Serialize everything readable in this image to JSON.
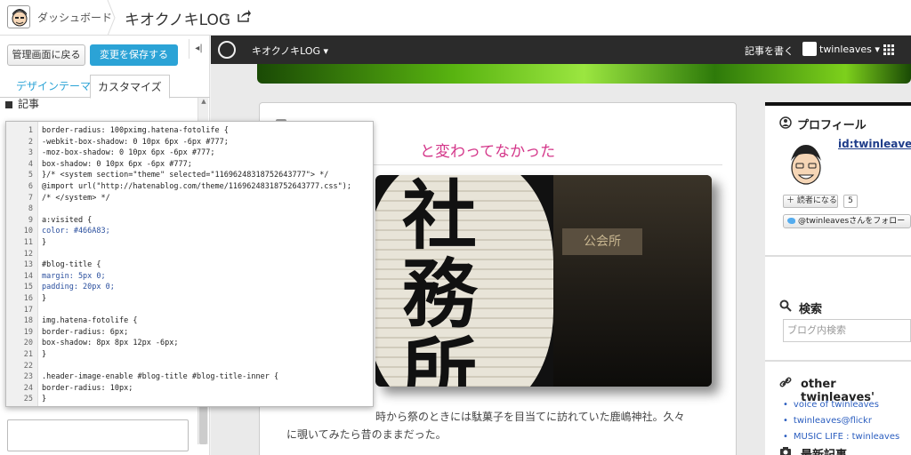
{
  "topbar": {
    "dashboard_label": "ダッシュボード",
    "blog_name": "キオクノキLOG",
    "caret": "▾"
  },
  "leftpane": {
    "back_button": "管理画面に戻る",
    "save_button": "変更を保存する",
    "collapse": "◂|",
    "tabs": [
      {
        "label": "デザインテーマ",
        "active": false
      },
      {
        "label": "カスタマイズ",
        "active": true
      }
    ],
    "section_label": "記事",
    "scroll_up": "▲"
  },
  "editor": {
    "lines": [
      {
        "n": "1",
        "code": "border-radius: 100pximg.hatena-fotolife {"
      },
      {
        "n": "2",
        "code": "-webkit-box-shadow: 0 10px 6px -6px #777;"
      },
      {
        "n": "3",
        "code": "-moz-box-shadow: 0 10px 6px -6px #777;"
      },
      {
        "n": "4",
        "code": "box-shadow: 0 10px 6px -6px #777;"
      },
      {
        "n": "5",
        "code": "}/* <system section=\"theme\" selected=\"11696248318752643777\"> */"
      },
      {
        "n": "6",
        "code": "@import url(\"http://hatenablog.com/theme/11696248318752643777.css\");"
      },
      {
        "n": "7",
        "code": "/* </system> */"
      },
      {
        "n": "8",
        "code": ""
      },
      {
        "n": "9",
        "code": "a:visited {"
      },
      {
        "n": "10",
        "code": "color: #466A83;"
      },
      {
        "n": "11",
        "code": "}"
      },
      {
        "n": "12",
        "code": ""
      },
      {
        "n": "13",
        "code": "#blog-title {"
      },
      {
        "n": "14",
        "code": "margin: 5px 0;"
      },
      {
        "n": "15",
        "code": "padding: 20px 0;"
      },
      {
        "n": "16",
        "code": "}"
      },
      {
        "n": "17",
        "code": ""
      },
      {
        "n": "18",
        "code": "img.hatena-fotolife {"
      },
      {
        "n": "19",
        "code": "border-radius: 6px;"
      },
      {
        "n": "20",
        "code": "box-shadow: 8px 8px 12px -6px;"
      },
      {
        "n": "21",
        "code": "}"
      },
      {
        "n": "22",
        "code": ""
      },
      {
        "n": "23",
        "code": ".header-image-enable #blog-title #blog-title-inner {"
      },
      {
        "n": "24",
        "code": "border-radius: 10px;"
      },
      {
        "n": "25",
        "code": "}"
      }
    ]
  },
  "preview": {
    "nav_title": "キオクノキLOG ▾",
    "write_label": "記事を書く",
    "user_label": "twinleaves ▾",
    "entry_title": "と変わってなかった",
    "photo_glyphs": [
      "社",
      "務",
      "所"
    ],
    "photo_sign": "公会所",
    "entry_text_1": "時から祭のときには駄菓子を目当てに訪れていた鹿嶋神社。久々",
    "entry_text_2": "に覗いてみたら昔のままだった。",
    "sidebar": {
      "profile_title": "プロフィール",
      "profile_id": "id:twinleaves",
      "reader_button": "読者になる",
      "reader_count": "5",
      "twitter_button": "@twinleavesさんをフォロー",
      "search_title": "検索",
      "search_placeholder": "ブログ内検索",
      "links_title": "other twinleaves'",
      "links": [
        "voice of twinleaves",
        "twinleaves@flickr",
        "MUSIC LIFE : twinleaves"
      ],
      "recent_title": "最新記事"
    }
  },
  "colors": {
    "accent_blue": "#2ba3d6",
    "title_pink": "#d4378a",
    "link_blue": "#2a5dbf"
  }
}
